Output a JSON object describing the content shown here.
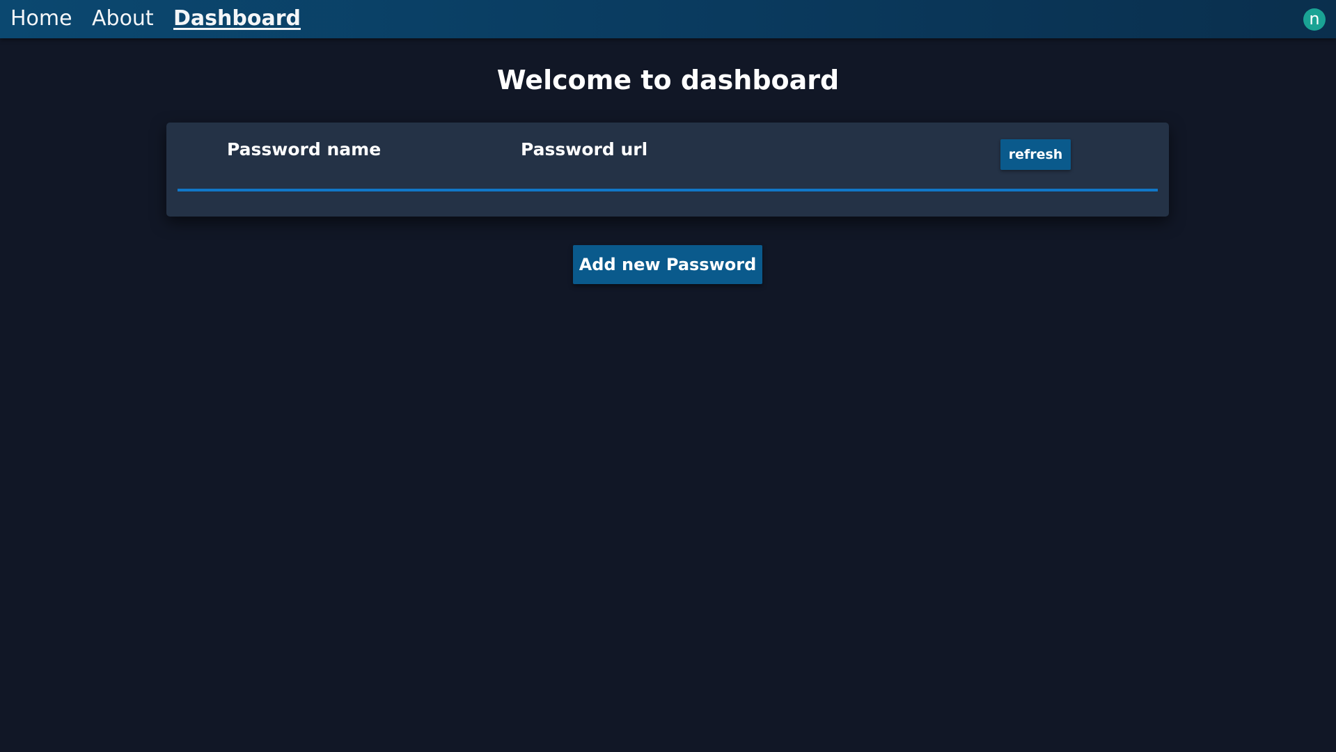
{
  "nav": {
    "links": [
      "Home",
      "About",
      "Dashboard"
    ],
    "active": "Dashboard",
    "avatar_letter": "n"
  },
  "page": {
    "title": "Welcome to dashboard"
  },
  "table": {
    "columns": [
      "Password name",
      "Password url"
    ],
    "refresh_label": "refresh",
    "rows": []
  },
  "actions": {
    "add_label": "Add new Password"
  },
  "colors": {
    "background": "#111726",
    "navbar": "#0a3a5e",
    "panel": "#243246",
    "accent_button": "#0a5a8c",
    "divider": "#1177c7",
    "avatar": "#1aa394"
  }
}
